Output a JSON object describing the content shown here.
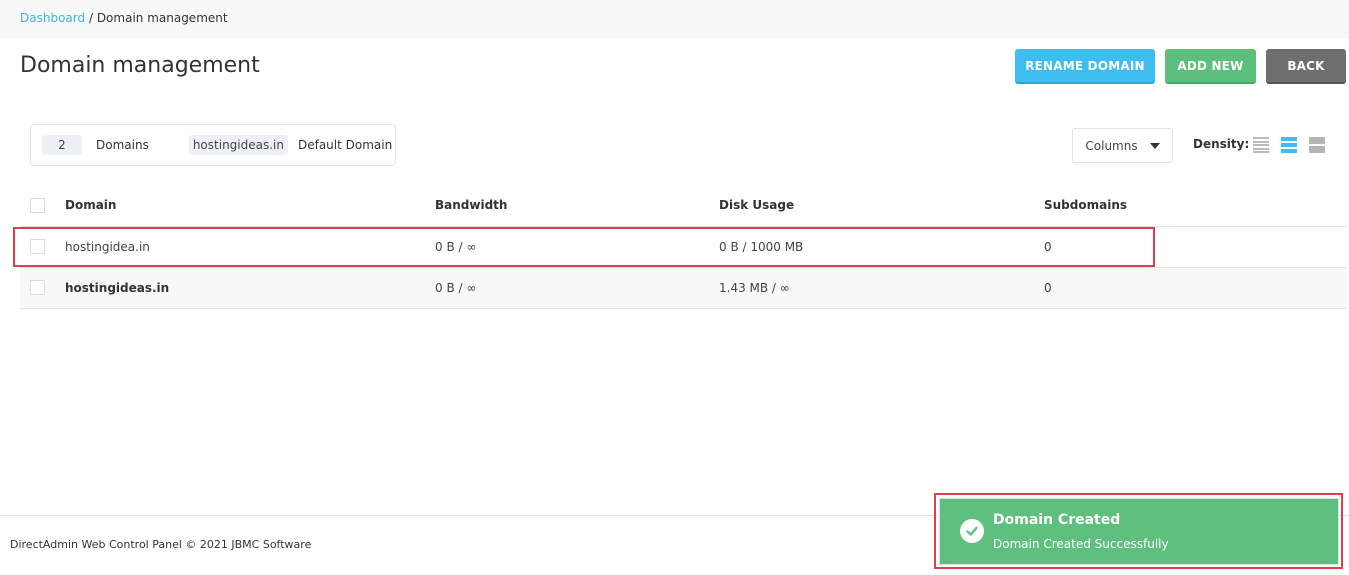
{
  "breadcrumb": {
    "link": "Dashboard",
    "separator": "/",
    "current": "Domain management"
  },
  "page_title": "Domain management",
  "actions": {
    "rename_label": "RENAME DOMAIN",
    "add_label": "ADD NEW",
    "back_label": "BACK"
  },
  "stats": {
    "count": "2",
    "count_label": "Domains",
    "default_domain": "hostingideas.in",
    "default_label": "Default Domain"
  },
  "toolbar": {
    "columns_label": "Columns",
    "density_label": "Density:",
    "density_options": [
      "compact",
      "normal",
      "comfortable"
    ],
    "density_selected": "normal"
  },
  "table": {
    "headers": [
      "Domain",
      "Bandwidth",
      "Disk Usage",
      "Subdomains"
    ],
    "rows": [
      {
        "domain": "hostingidea.in",
        "bandwidth": "0 B / ∞",
        "disk_usage": "0 B / 1000 MB",
        "subdomains": "0",
        "default": false
      },
      {
        "domain": "hostingideas.in",
        "bandwidth": "0 B / ∞",
        "disk_usage": "1.43 MB / ∞",
        "subdomains": "0",
        "default": true
      }
    ]
  },
  "footer": {
    "text": "DirectAdmin Web Control Panel © 2021 JBMC Software"
  },
  "toast": {
    "title": "Domain Created",
    "message": "Domain Created Successfully",
    "icon": "check-circle-icon"
  },
  "colors": {
    "accent": "#3dbdf0",
    "success": "#5fbf7f",
    "neutral": "#6e6e6e",
    "highlight": "#d9414d"
  }
}
